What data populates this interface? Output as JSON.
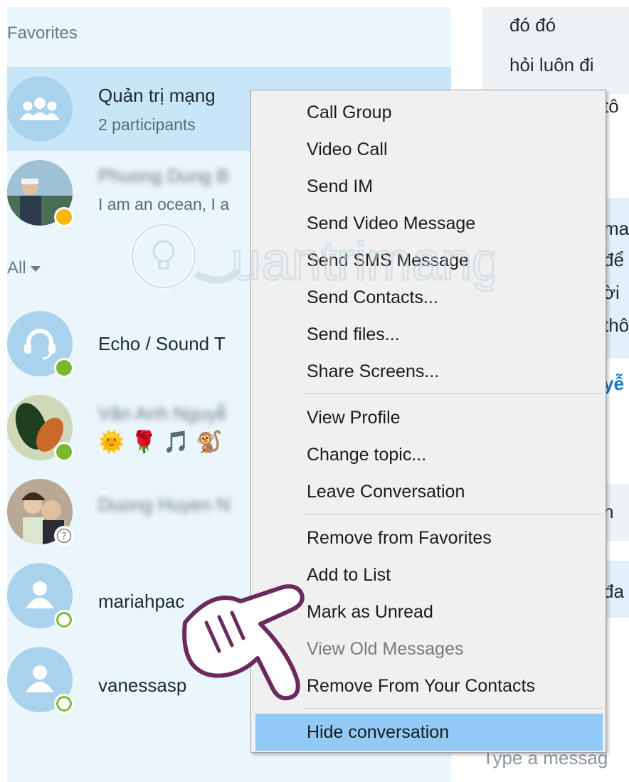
{
  "sections": {
    "favorites": "Favorites",
    "all": "All"
  },
  "favorites": [
    {
      "name": "Quản trị mạng",
      "sub": "2 participants",
      "avatar": "group-icon"
    },
    {
      "name": "Phuong Dung B",
      "sub": "I am an ocean, I a",
      "avatar": "photo",
      "status": "away"
    }
  ],
  "contacts": [
    {
      "name": "Echo / Sound T",
      "avatar": "headset-icon",
      "status": "online"
    },
    {
      "name": "Văn Anh Nguyễ",
      "emoji": "🌞 🌹 🎵 🐒",
      "avatar": "photo",
      "status": "online"
    },
    {
      "name": "Duong Huyen N",
      "avatar": "photo",
      "status": "unknown"
    },
    {
      "name": "mariahpac",
      "avatar": "person-icon",
      "status": "offline"
    },
    {
      "name": "vanessasp",
      "avatar": "person-icon",
      "status": "offline"
    }
  ],
  "chat": {
    "lines": [
      "đó đó",
      "hỏi luôn đi"
    ],
    "partials": [
      "tô",
      "ma",
      "để",
      "ời",
      "thô",
      "yễ",
      "n",
      "đa"
    ],
    "input_placeholder": "Type a messag"
  },
  "menu": {
    "items": [
      {
        "label": "Call Group"
      },
      {
        "label": "Video Call"
      },
      {
        "label": "Send IM"
      },
      {
        "label": "Send Video Message"
      },
      {
        "label": "Send SMS Message"
      },
      {
        "label": "Send Contacts..."
      },
      {
        "label": "Send files..."
      },
      {
        "label": "Share Screens..."
      },
      {
        "label": "View Profile"
      },
      {
        "label": "Change topic..."
      },
      {
        "label": "Leave Conversation"
      },
      {
        "label": "Remove from Favorites"
      },
      {
        "label": "Add to List"
      },
      {
        "label": "Mark as Unread"
      },
      {
        "label": "View Old Messages",
        "disabled": true
      },
      {
        "label": "Remove From Your Contacts"
      },
      {
        "label": "Hide conversation",
        "highlighted": true
      }
    ]
  },
  "colors": {
    "list_bg": "#ebf5fc",
    "selected": "#c8e6f7",
    "menu_bg": "#f0f0f0",
    "menu_highlight": "#91c9f7",
    "online": "#7cb82f",
    "away": "#f8b700"
  }
}
